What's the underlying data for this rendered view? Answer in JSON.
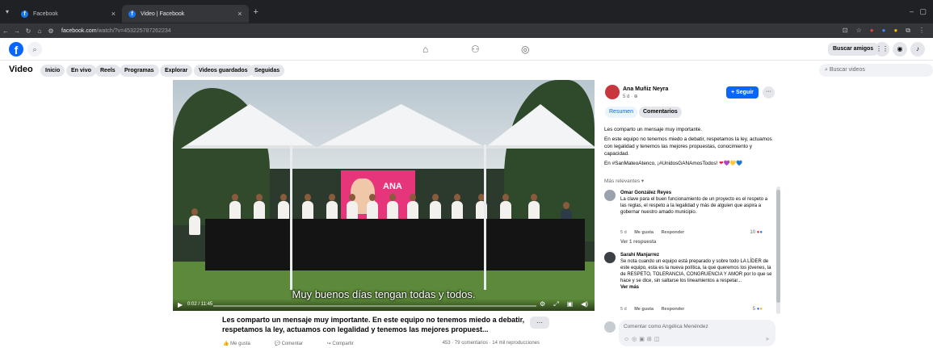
{
  "browser": {
    "tabs": [
      {
        "label": "Facebook",
        "close": "×"
      },
      {
        "label": "Video | Facebook",
        "close": "×"
      }
    ],
    "new_tab": "+",
    "url_host": "facebook.com",
    "url_path": "/watch/?v=453225787262234"
  },
  "header": {
    "logo": "f",
    "buscar_amigos": "Buscar amigos"
  },
  "video_nav": {
    "title": "Video",
    "pills": [
      "Inicio",
      "En vivo",
      "Reels",
      "Programas",
      "Explorar",
      "Videos guardados",
      "Seguidas"
    ],
    "search_placeholder": "Buscar videos"
  },
  "player": {
    "banner_name": "ANA",
    "subtitle": "Muy buenos días tengan todas y todos.",
    "time": "0:02 / 11:45"
  },
  "post": {
    "caption": "Les comparto un mensaje muy importante. En este equipo no tenemos miedo a debatir, respetamos la ley, actuamos con legalidad y tenemos las mejores propuest...",
    "more": "···",
    "like": "Me gusta",
    "comment": "Comentar",
    "share": "Compartir",
    "stats": "453 · 79 comentarios · 14 mil reproducciones"
  },
  "panel": {
    "author": "Ana Muñiz Neyra",
    "meta": "5 d · ⊕",
    "follow": "Seguir",
    "dots": "···",
    "tab_resumen": "Resumen",
    "tab_comentarios": "Comentarios",
    "desc_1": "Les comparto un mensaje muy importante.",
    "desc_2": "En este equipo no tenemos miedo a debatir, respetamos la ley, actuamos con legalidad y tenemos las mejores propuestas, conocimiento y capacidad.",
    "desc_3": "En #SanMateoAtenco, ¡#UnidosGANAmosTodos!",
    "hearts": "❤💜💛💙",
    "relevant": "Más relevantes ▾",
    "comments": [
      {
        "name": "Omar González Reyes",
        "text": "La clave para el buen funcionamiento de un proyecto es el respeto a las reglas, el respeto a la legalidad y más de alguien que aspira a gobernar nuestro amado municipio.",
        "time": "5 d",
        "like": "Me gusta",
        "reply": "Responder",
        "reactions": "10"
      },
      {
        "name": "Sarahí Manjarrez",
        "text": "Se nota cuando un equipo está preparado y sobre todo LA LÍDER de este equipo, esta es la nueva política, la que queremos los jóvenes, la de RESPETO, TOLERANCIA, CONGRUENCIA Y AMOR por lo que se hace y se dice, sin saltarse los lineamientos a respetar...",
        "see_more": "Ver más",
        "time": "5 d",
        "like": "Me gusta",
        "reply": "Responder",
        "reactions": "5"
      }
    ],
    "view_reply": "Ver 1 respuesta",
    "composer_placeholder": "Comentar como Angélica Menéndez"
  }
}
